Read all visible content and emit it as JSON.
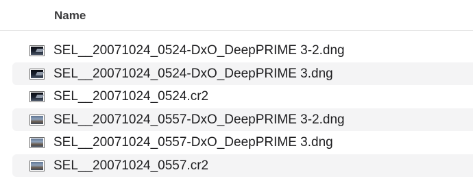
{
  "header": {
    "name_column": "Name"
  },
  "files": [
    {
      "name": "SEL__20071024_0524-DxO_DeepPRIME 3-2.dng",
      "icon": "dark-photo-thumbnail-icon"
    },
    {
      "name": "SEL__20071024_0524-DxO_DeepPRIME 3.dng",
      "icon": "dark-photo-thumbnail-icon"
    },
    {
      "name": "SEL__20071024_0524.cr2",
      "icon": "dark-photo-thumbnail-icon"
    },
    {
      "name": "SEL__20071024_0557-DxO_DeepPRIME 3-2.dng",
      "icon": "landscape-photo-thumbnail-icon"
    },
    {
      "name": "SEL__20071024_0557-DxO_DeepPRIME 3.dng",
      "icon": "landscape-photo-thumbnail-icon"
    },
    {
      "name": "SEL__20071024_0557.cr2",
      "icon": "landscape-photo-thumbnail-icon"
    }
  ]
}
